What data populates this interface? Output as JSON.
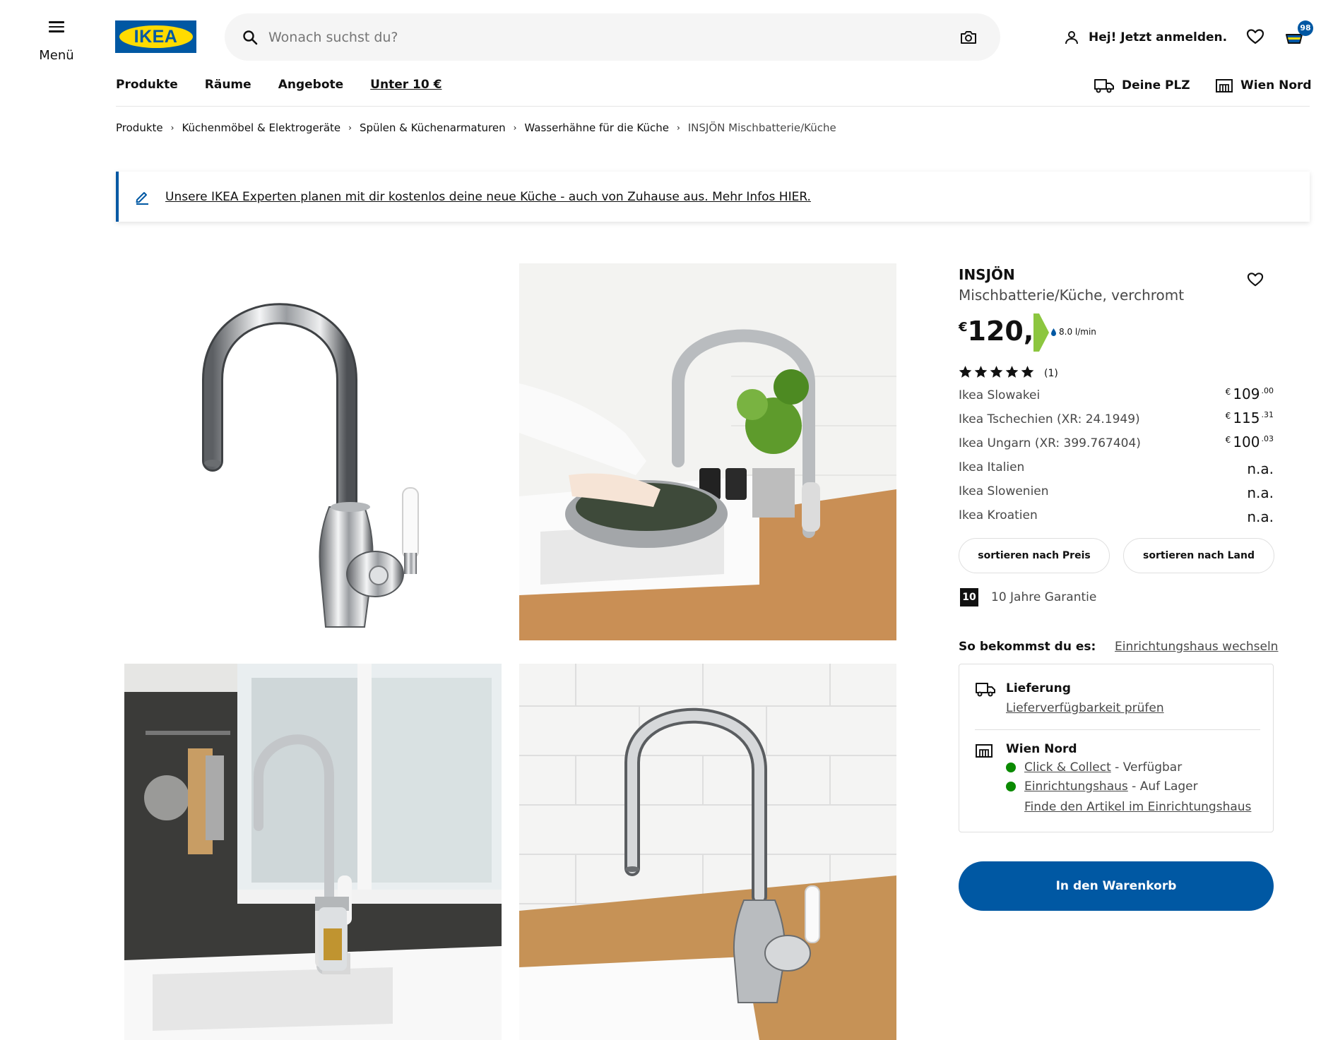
{
  "header": {
    "menu_label": "Menü",
    "logo_text": "IKEA",
    "search_placeholder": "Wonach suchst du?",
    "login_label": "Hej! Jetzt anmelden.",
    "cart_count": "98",
    "brand_blue": "#0058a3",
    "brand_yellow": "#ffdb00"
  },
  "nav": {
    "items": [
      "Produkte",
      "Räume",
      "Angebote",
      "Unter 10 €"
    ],
    "postal_label": "Deine PLZ",
    "store_label": "Wien Nord"
  },
  "breadcrumb": [
    "Produkte",
    "Küchenmöbel & Elektrogeräte",
    "Spülen & Küchenarmaturen",
    "Wasserhähne für die Küche",
    "INSJÖN Mischbatterie/Küche"
  ],
  "banner": {
    "text": "Unsere IKEA Experten planen mit dir kostenlos deine neue Küche - auch von Zuhause aus. Mehr Infos HIER."
  },
  "product": {
    "name": "INSJÖN",
    "description": "Mischbatterie/Küche, verchromt",
    "price_currency": "€",
    "price_amount": "120,-",
    "energy_color": "#8cc63f",
    "flow_rate": "8.0 l/min",
    "rating": 5,
    "rating_count": "(1)"
  },
  "price_compare": [
    {
      "country": "Ikea Slowakei",
      "suffix": "",
      "euro": "€",
      "main": "109",
      "dec": ".00"
    },
    {
      "country": "Ikea Tschechien",
      "suffix": " (XR: 24.1949)",
      "euro": "€",
      "main": "115",
      "dec": ".31"
    },
    {
      "country": "Ikea Ungarn",
      "suffix": " (XR: 399.767404)",
      "euro": "€",
      "main": "100",
      "dec": ".03"
    },
    {
      "country": "Ikea Italien",
      "suffix": "",
      "na": "n.a."
    },
    {
      "country": "Ikea Slowenien",
      "suffix": "",
      "na": "n.a."
    },
    {
      "country": "Ikea Kroatien",
      "suffix": "",
      "na": "n.a."
    }
  ],
  "sort": {
    "by_price": "sortieren nach Preis",
    "by_country": "sortieren nach Land"
  },
  "guarantee": {
    "badge": "10",
    "text": "10 Jahre Garantie"
  },
  "availability": {
    "heading": "So bekommst du es:",
    "change_store": "Einrichtungshaus wechseln",
    "delivery_title": "Lieferung",
    "delivery_link": "Lieferverfügbarkeit prüfen",
    "store_title": "Wien Nord",
    "click_collect_link": "Click & Collect",
    "click_collect_status": " - Verfügbar",
    "store_link": "Einrichtungshaus",
    "store_status": " - Auf Lager",
    "find_link": "Finde den Artikel im Einrichtungshaus",
    "status_color": "#0a8a00"
  },
  "cta": {
    "add_to_cart": "In den Warenkorb"
  }
}
